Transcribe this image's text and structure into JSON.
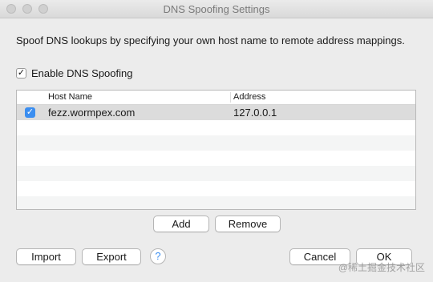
{
  "window": {
    "title": "DNS Spoofing Settings"
  },
  "description": "Spoof DNS lookups by specifying your own host name to remote address mappings.",
  "enable_checkbox": {
    "label": "Enable DNS Spoofing",
    "checked": true
  },
  "table": {
    "columns": [
      "Host Name",
      "Address"
    ],
    "rows": [
      {
        "enabled": true,
        "host": "fezz.wormpex.com",
        "address": "127.0.0.1"
      }
    ]
  },
  "buttons": {
    "add": "Add",
    "remove": "Remove",
    "import": "Import",
    "export": "Export",
    "help": "?",
    "cancel": "Cancel",
    "ok": "OK"
  },
  "icons": {
    "check": "✓"
  },
  "watermark": "@稀土掘金技术社区",
  "colors": {
    "accent": "#3b8ef0",
    "selection": "#dcdcdc"
  }
}
